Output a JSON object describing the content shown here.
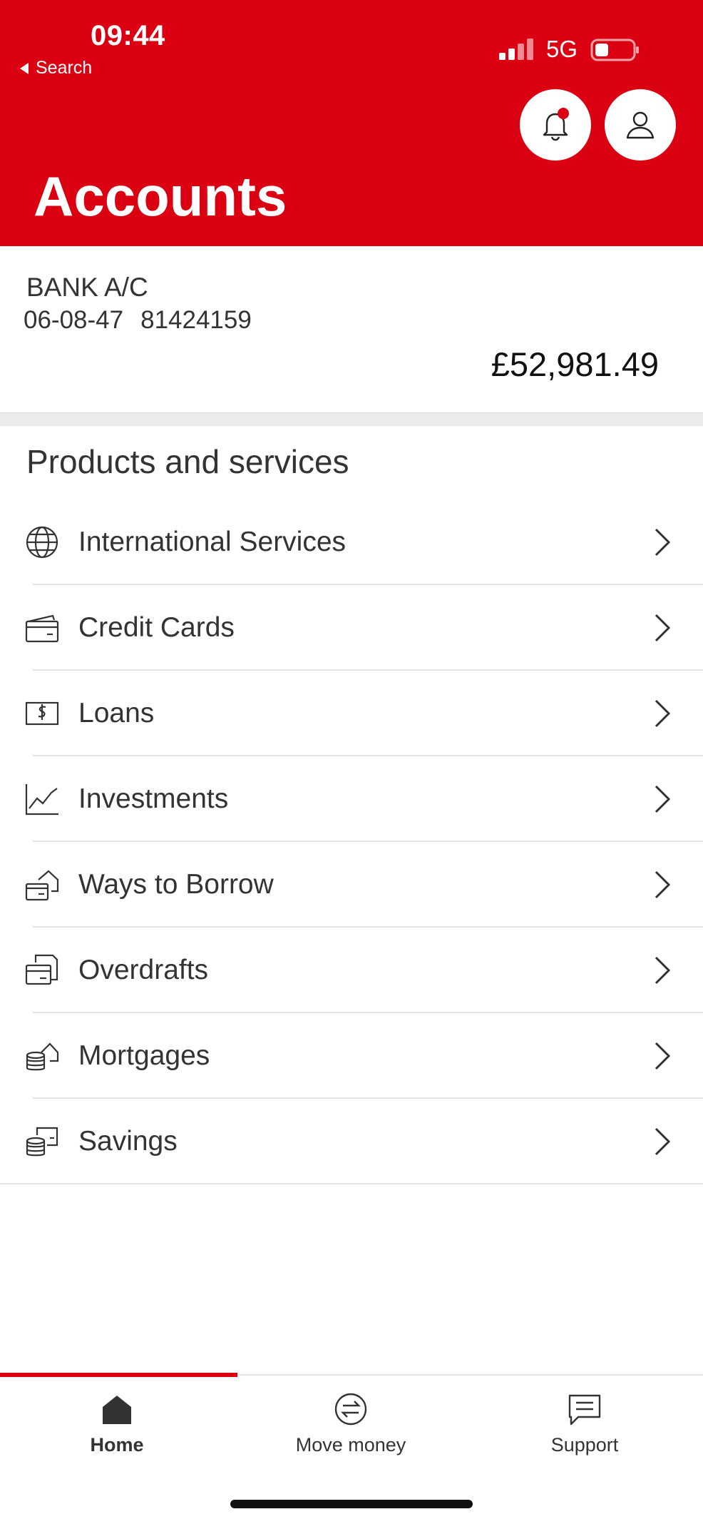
{
  "status_bar": {
    "time": "09:44",
    "back_label": "Search",
    "network": "5G"
  },
  "header": {
    "title": "Accounts",
    "notification_dot_color": "#db0011",
    "brand_color": "#db0011"
  },
  "account": {
    "name": "BANK A/C",
    "sort_code": "06-08-47",
    "account_number": "81424159",
    "balance": "£52,981.49"
  },
  "products": {
    "title": "Products and services",
    "items": [
      {
        "label": "International Services",
        "icon": "globe-icon"
      },
      {
        "label": "Credit Cards",
        "icon": "credit-card-icon"
      },
      {
        "label": "Loans",
        "icon": "cash-icon"
      },
      {
        "label": "Investments",
        "icon": "line-chart-icon"
      },
      {
        "label": "Ways to Borrow",
        "icon": "house-card-icon"
      },
      {
        "label": "Overdrafts",
        "icon": "card-document-icon"
      },
      {
        "label": "Mortgages",
        "icon": "coins-house-icon"
      },
      {
        "label": "Savings",
        "icon": "coins-screen-icon"
      }
    ]
  },
  "bottom_nav": {
    "home": "Home",
    "move_money": "Move money",
    "support": "Support",
    "active": "Home"
  }
}
